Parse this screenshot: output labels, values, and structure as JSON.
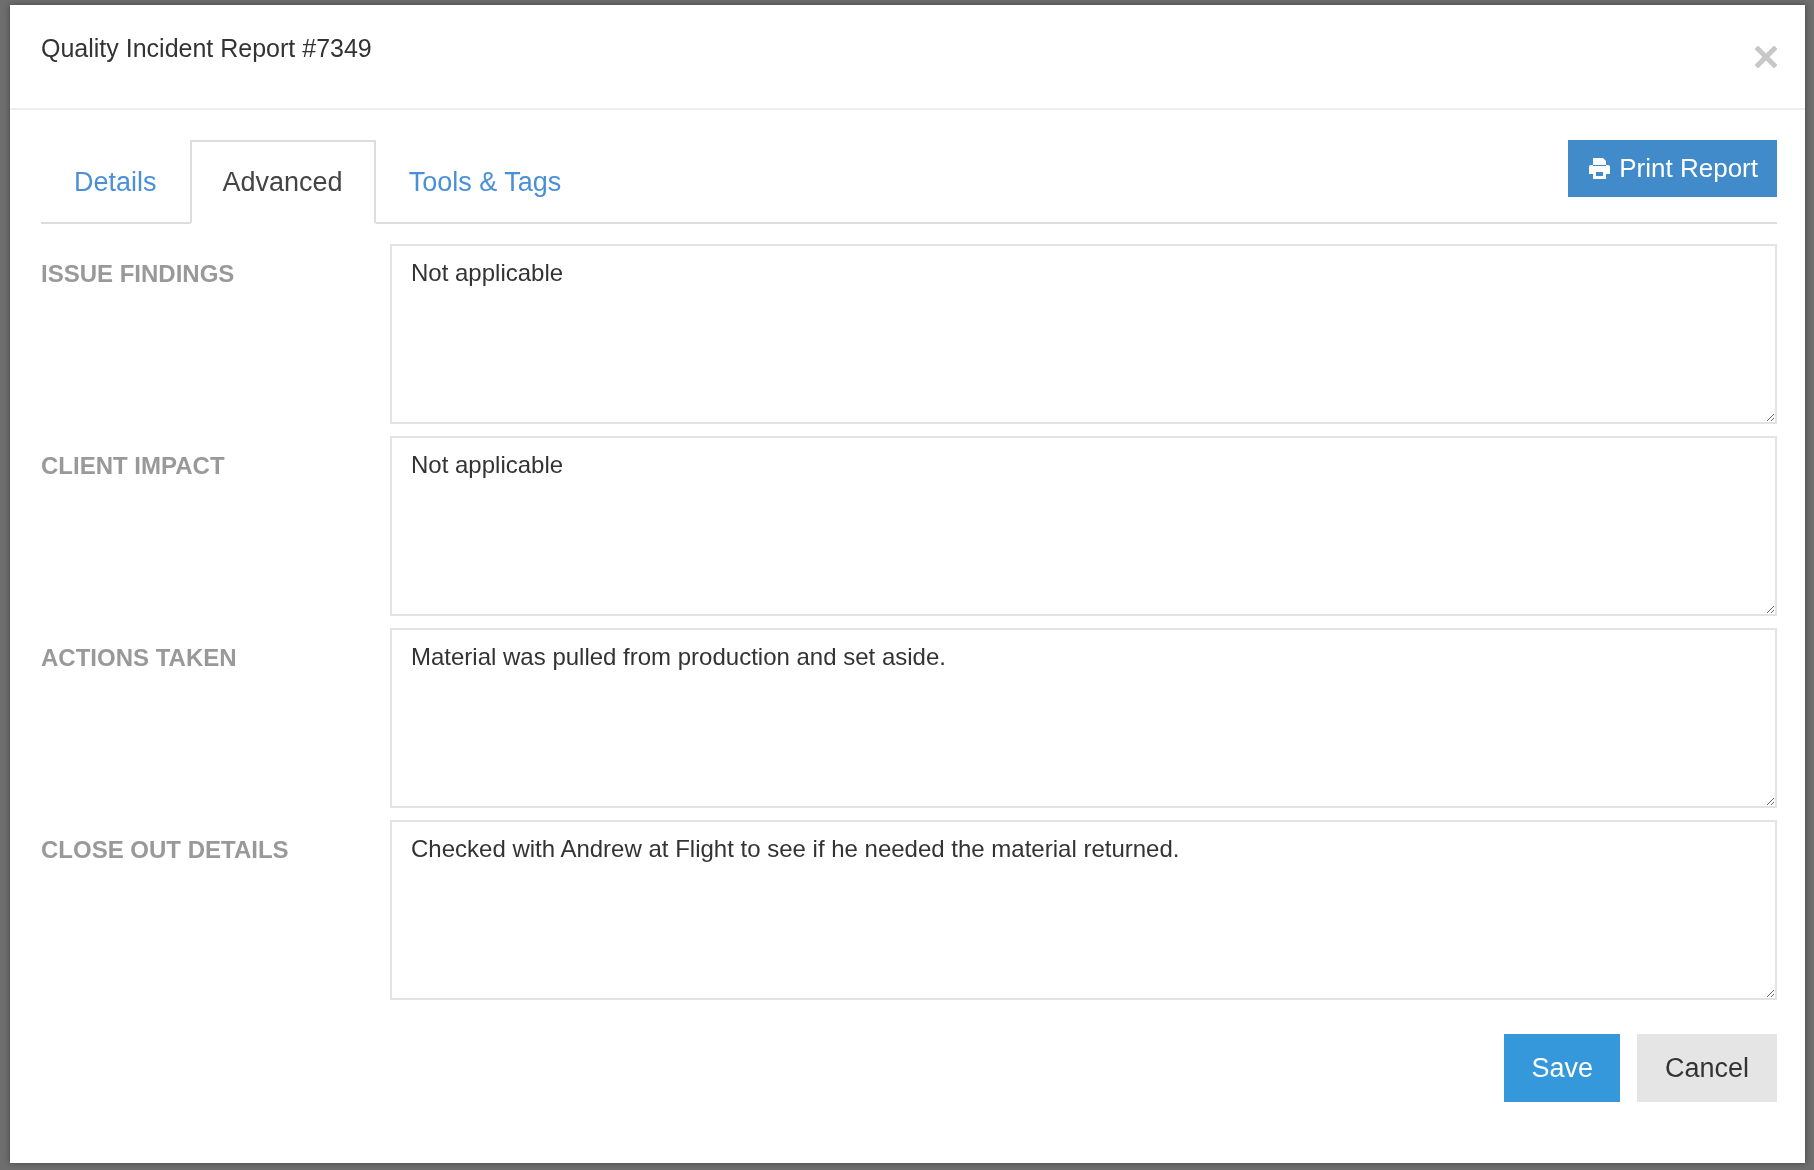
{
  "dialog": {
    "title": "Quality Incident Report #7349"
  },
  "tabs": [
    {
      "label": "Details",
      "selected": false
    },
    {
      "label": "Advanced",
      "selected": true
    },
    {
      "label": "Tools & Tags",
      "selected": false
    }
  ],
  "print_button": {
    "label": "Print Report"
  },
  "fields": [
    {
      "label": "ISSUE FINDINGS",
      "value": "Not applicable"
    },
    {
      "label": "CLIENT IMPACT",
      "value": "Not applicable"
    },
    {
      "label": "ACTIONS TAKEN",
      "value": "Material was pulled from production and set aside."
    },
    {
      "label": "CLOSE OUT DETAILS",
      "value": "Checked with Andrew at Flight to see if he needed the material returned."
    }
  ],
  "buttons": [
    {
      "kind": "primary",
      "label": "Save"
    },
    {
      "kind": "secondary",
      "label": "Cancel"
    }
  ]
}
